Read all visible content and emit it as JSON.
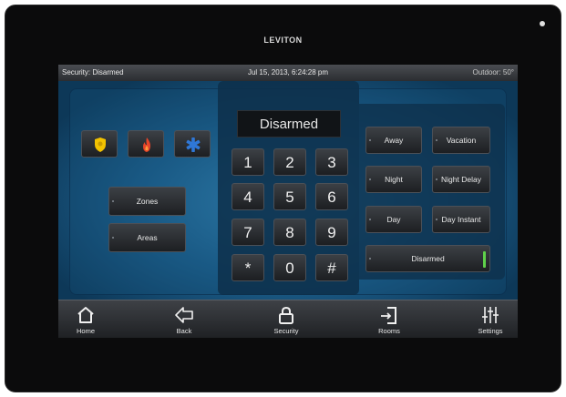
{
  "brand": "LEVITON",
  "statusbar": {
    "left": "Security: Disarmed",
    "center": "Jul 15, 2013, 6:24:28 pm",
    "right": "Outdoor: 50°"
  },
  "display": "Disarmed",
  "keypad": [
    "1",
    "2",
    "3",
    "4",
    "5",
    "6",
    "7",
    "8",
    "9",
    "*",
    "0",
    "#"
  ],
  "left_buttons": {
    "zones": "Zones",
    "areas": "Areas"
  },
  "modes": {
    "away": "Away",
    "vacation": "Vacation",
    "night": "Night",
    "night_delay": "Night Delay",
    "day": "Day",
    "day_instant": "Day Instant",
    "disarmed": "Disarmed"
  },
  "nav": {
    "home": "Home",
    "back": "Back",
    "security": "Security",
    "rooms": "Rooms",
    "settings": "Settings"
  },
  "icons": {
    "police": "police-badge-icon",
    "fire": "fire-icon",
    "medical": "medical-star-icon"
  },
  "colors": {
    "police": "#f2c200",
    "fire": "#e8452a",
    "medical": "#2f77d6",
    "armed_led": "#5fd14a"
  }
}
